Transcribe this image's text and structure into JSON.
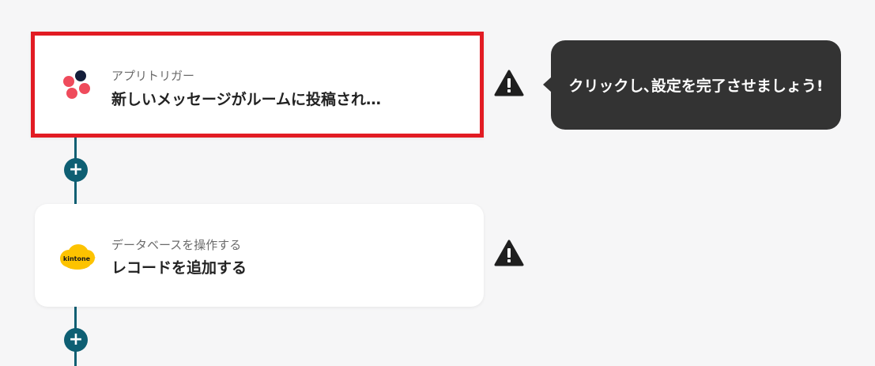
{
  "flow": {
    "steps": [
      {
        "app_icon": "chatwork-icon",
        "category_label": "アプリトリガー",
        "title": "新しいメッセージがルームに投稿され…"
      },
      {
        "app_icon": "kintone-icon",
        "app_icon_text": "kintone",
        "category_label": "データベースを操作する",
        "title": "レコードを追加する"
      }
    ],
    "add_step_symbol": "+",
    "warning_icon": "warning-triangle-icon"
  },
  "tooltip": {
    "text": "クリックし､設定を完了させましょう!"
  },
  "colors": {
    "background": "#f6f6f7",
    "connector": "#0e5f73",
    "selected_border": "#e21b23",
    "tooltip_bg": "#333333",
    "warning": "#1f1f1f",
    "kintone_yellow": "#fdc300"
  }
}
